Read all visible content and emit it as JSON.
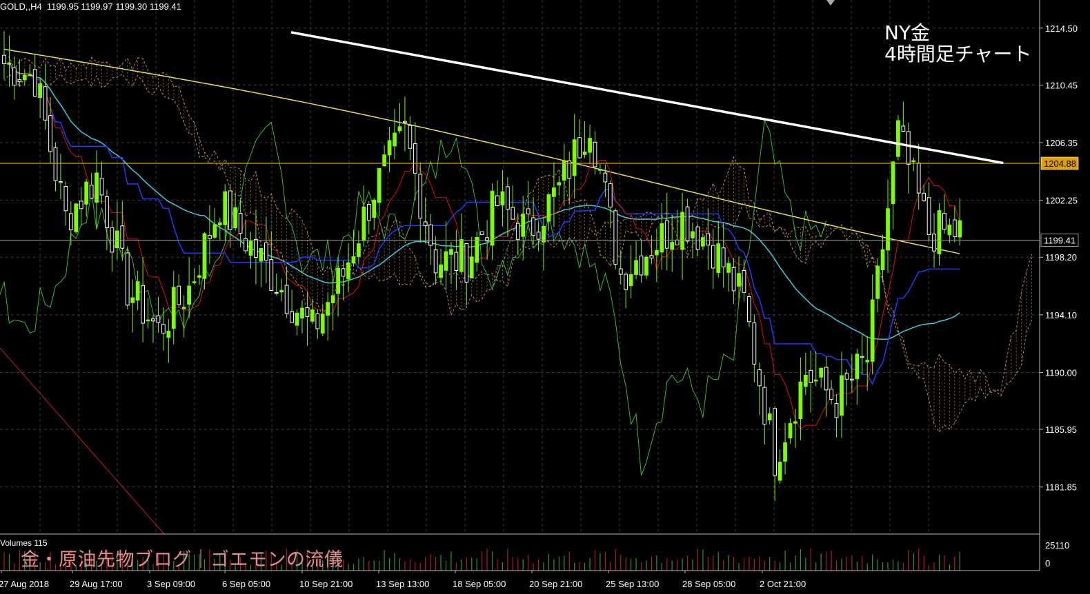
{
  "header": {
    "symbol": "GOLD,,H4",
    "ohlc": "1199.95 1199.97 1199.30 1199.41"
  },
  "annotation": {
    "line1": "NY金",
    "line2": "4時間足チャート"
  },
  "watermark": "金・原油先物ブログ｜ゴエモンの流儀",
  "volume": {
    "label": "Volumes 115",
    "max": "25110",
    "min": "0"
  },
  "colors": {
    "bullish": "#7CFC00",
    "bearish": "#ffffff",
    "tenkan": "#e01010",
    "kijun": "#1f3cff",
    "ma_short": "#35d0e0",
    "ma_long": "#e8e040",
    "chikou": "#3cb83c",
    "cloud": "#c88a6a",
    "hline": "#e0a000",
    "trendline": "#ffffff"
  },
  "chart_data": {
    "type": "candlestick",
    "symbol": "GOLD",
    "timeframe": "H4",
    "ylim": [
      1178.5,
      1216.5
    ],
    "y_ticks": [
      "1214.50",
      "1210.45",
      "1206.35",
      "1202.25",
      "1198.20",
      "1194.10",
      "1190.00",
      "1185.95",
      "1181.85"
    ],
    "x_ticks": [
      "27 Aug 2018",
      "29 Aug 17:00",
      "3 Sep 09:00",
      "6 Sep 05:00",
      "10 Sep 21:00",
      "13 Sep 13:00",
      "18 Sep 05:00",
      "20 Sep 21:00",
      "25 Sep 13:00",
      "28 Sep 05:00",
      "2 Oct 21:00"
    ],
    "horizontal_line": {
      "value": 1204.88,
      "label": "1204.88"
    },
    "current_price": {
      "value": 1199.41,
      "label": "1199.41"
    },
    "trendline": {
      "from": {
        "bar": 0.28,
        "price": 1214.2
      },
      "to": {
        "bar": 0.965,
        "price": 1204.9
      }
    },
    "anchors": [
      [
        0,
        1212
      ],
      [
        6,
        1211
      ],
      [
        12,
        1201
      ],
      [
        18,
        1204
      ],
      [
        24,
        1196
      ],
      [
        30,
        1193
      ],
      [
        36,
        1196
      ],
      [
        42,
        1202
      ],
      [
        48,
        1199
      ],
      [
        54,
        1196
      ],
      [
        60,
        1193
      ],
      [
        66,
        1197
      ],
      [
        72,
        1203
      ],
      [
        78,
        1207
      ],
      [
        84,
        1198
      ],
      [
        90,
        1198
      ],
      [
        96,
        1202
      ],
      [
        102,
        1200
      ],
      [
        108,
        1203
      ],
      [
        114,
        1208
      ],
      [
        120,
        1197
      ],
      [
        126,
        1199
      ],
      [
        132,
        1201
      ],
      [
        138,
        1199
      ],
      [
        144,
        1195
      ],
      [
        150,
        1184
      ],
      [
        156,
        1190
      ],
      [
        162,
        1188
      ],
      [
        168,
        1191
      ],
      [
        174,
        1207
      ],
      [
        180,
        1200
      ],
      [
        186,
        1200
      ]
    ],
    "bars": 187
  }
}
